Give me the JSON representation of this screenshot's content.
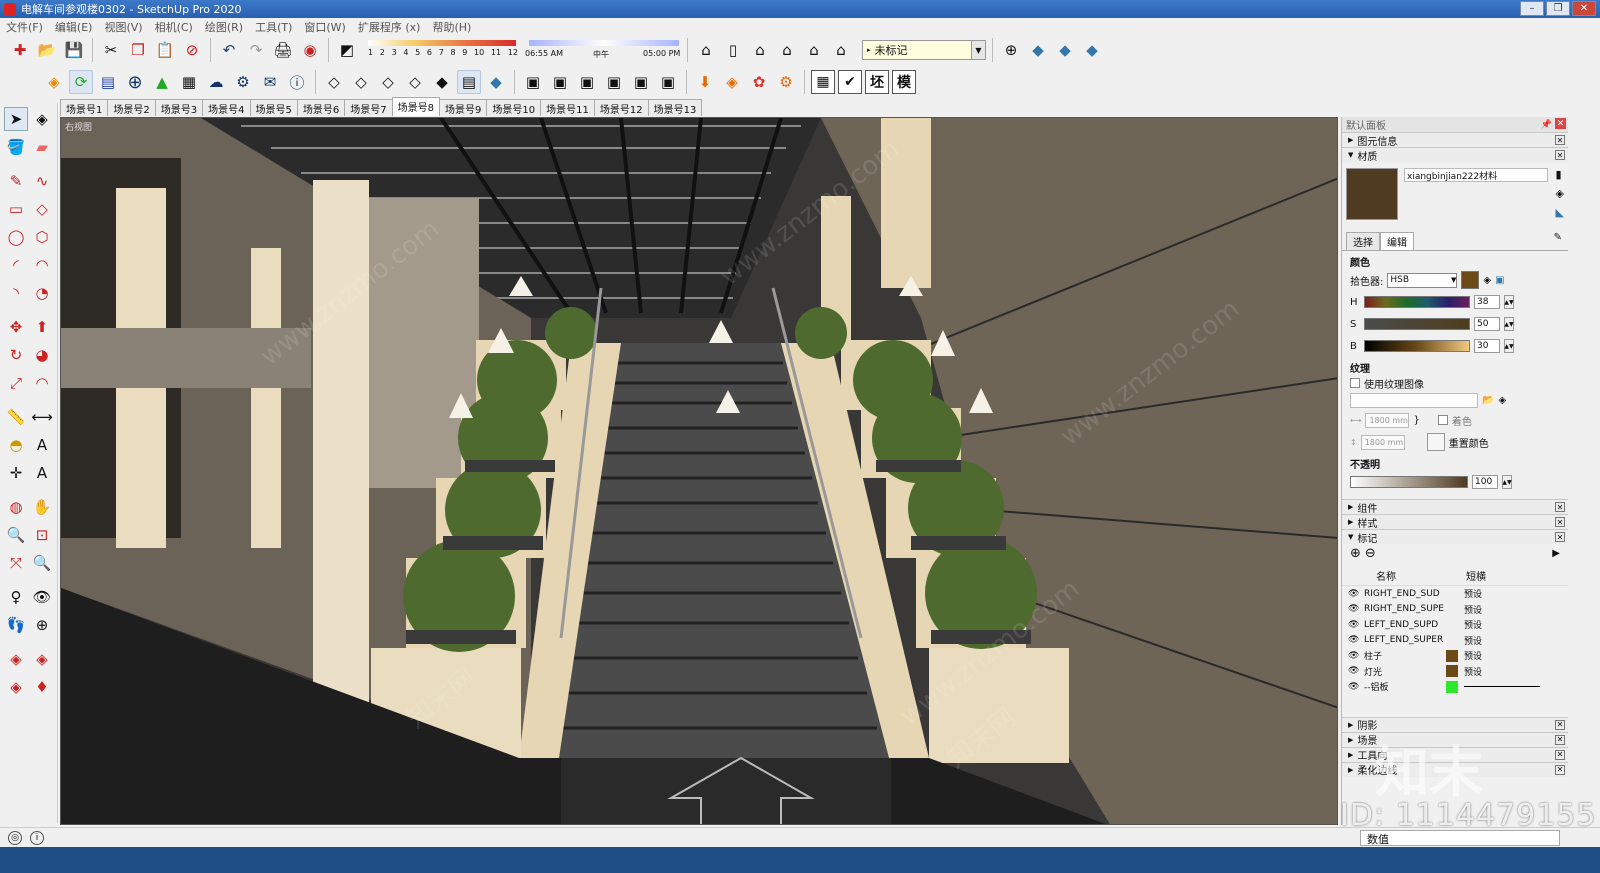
{
  "window": {
    "title": "电解车间参观楼0302 - SketchUp Pro 2020",
    "controls": [
      "–",
      "❐",
      "✕"
    ]
  },
  "menu": [
    "文件(F)",
    "编辑(E)",
    "视图(V)",
    "相机(C)",
    "绘图(R)",
    "工具(T)",
    "窗口(W)",
    "扩展程序 (x)",
    "帮助(H)"
  ],
  "shadows": {
    "months": [
      "1",
      "2",
      "3",
      "4",
      "5",
      "6",
      "7",
      "8",
      "9",
      "10",
      "11",
      "12"
    ],
    "time_start": "06:55 AM",
    "time_mid": "中午",
    "time_end": "05:00 PM"
  },
  "tag_dropdown": {
    "value": "未标记"
  },
  "letter_buttons": [
    "坯",
    "模"
  ],
  "scenes": [
    "场景号1",
    "场景号2",
    "场景号3",
    "场景号4",
    "场景号5",
    "场景号6",
    "场景号7",
    "场景号8",
    "场景号9",
    "场景号10",
    "场景号11",
    "场景号12",
    "场景号13"
  ],
  "active_scene": "场景号8",
  "viewport": {
    "label": "右视图"
  },
  "tray": {
    "title": "默认面板",
    "entity_info": "图元信息",
    "materials": "材质",
    "material_name": "xiangbinjian222材料",
    "tab_select": "选择",
    "tab_edit": "编辑",
    "color_label": "颜色",
    "picker_label": "拾色器:",
    "picker_value": "HSB",
    "h_label": "H",
    "h_value": "38",
    "s_label": "S",
    "s_value": "50",
    "b_label": "B",
    "b_value": "30",
    "texture_label": "纹理",
    "use_texture": "使用纹理图像",
    "width_placeholder": "1800 mm",
    "height_placeholder": "1800 mm",
    "colorize": "着色",
    "reset_color": "重置颜色",
    "opacity_label": "不透明",
    "opacity_value": "100",
    "components": "组件",
    "styles": "样式",
    "tags": "标记",
    "tag_col_name": "名称",
    "tag_col_dash": "短横",
    "tag_rows": [
      {
        "name": "RIGHT_END_SUD",
        "dash": "预设",
        "color": ""
      },
      {
        "name": "RIGHT_END_SUPE",
        "dash": "预设",
        "color": ""
      },
      {
        "name": "LEFT_END_SUPD",
        "dash": "预设",
        "color": ""
      },
      {
        "name": "LEFT_END_SUPER",
        "dash": "预设",
        "color": ""
      },
      {
        "name": "柱子",
        "dash": "预设",
        "color": "#6b4a18"
      },
      {
        "name": "灯光",
        "dash": "预设",
        "color": "#6b4a18"
      },
      {
        "name": "--铝板",
        "dash": "",
        "color": "#2ee82e"
      }
    ],
    "shadows": "阴影",
    "scenes": "场景",
    "toolset": "工具向",
    "soften": "柔化边线"
  },
  "colors": {
    "material_swatch": "#4f3b22",
    "titlebar": "#2a5fb0"
  },
  "status": {
    "measurements_label": "数值"
  },
  "watermark": {
    "id": "ID: 1114479155",
    "logo": "知末",
    "site": "www.znzmo.com",
    "cn": "知末网"
  }
}
